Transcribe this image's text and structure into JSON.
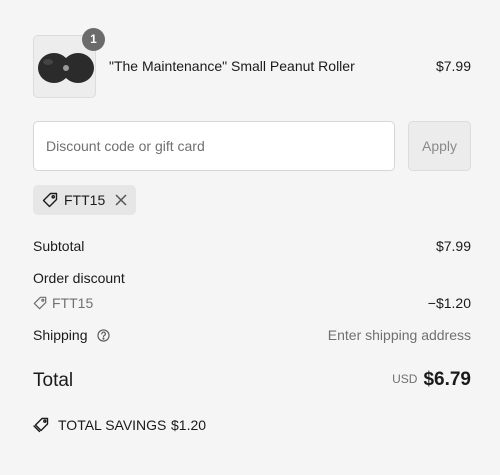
{
  "product": {
    "quantity": "1",
    "name": "\"The Maintenance\" Small Peanut Roller",
    "price": "$7.99"
  },
  "discount": {
    "placeholder": "Discount code or gift card",
    "value": "",
    "apply_label": "Apply",
    "applied_code": "FTT15"
  },
  "summary": {
    "subtotal_label": "Subtotal",
    "subtotal_value": "$7.99",
    "order_discount_label": "Order discount",
    "discount_code": "FTT15",
    "discount_value": "−$1.20",
    "shipping_label": "Shipping",
    "shipping_value": "Enter shipping address",
    "total_label": "Total",
    "currency": "USD",
    "total_value": "$6.79",
    "savings_label": "TOTAL SAVINGS",
    "savings_value": "$1.20"
  },
  "icons": {
    "tag": "tag-icon",
    "remove": "close-icon",
    "help": "question-circle-icon",
    "savings": "tags-icon"
  }
}
